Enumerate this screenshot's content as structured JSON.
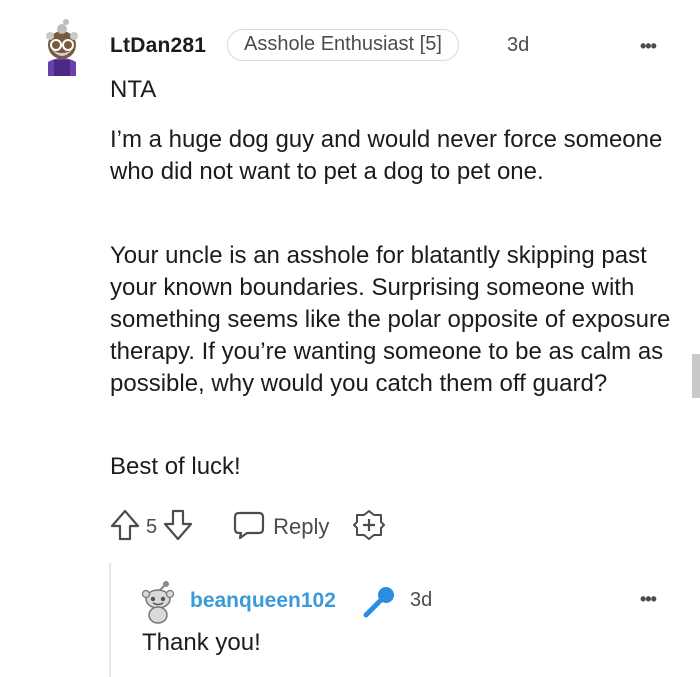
{
  "comment": {
    "username": "LtDan281",
    "flair": "Asshole Enthusiast [5]",
    "time": "3d",
    "more_label": "•••",
    "paragraphs": [
      "NTA",
      "I’m a huge dog guy and would never force someone who did not want to pet a dog to pet one.",
      "Your uncle is an asshole for blatantly skipping past your known boundaries. Surprising someone with something seems like the polar opposite of exposure therapy. If you’re wanting someone to be as calm as possible, why would you catch them off guard?",
      "Best of luck!"
    ],
    "vote_count": "5",
    "reply_label": "Reply"
  },
  "reply": {
    "username": "beanqueen102",
    "time": "3d",
    "more_label": "•••",
    "text": "Thank you!"
  },
  "icons": {
    "upvote": "arrow-up-icon",
    "downvote": "arrow-down-icon",
    "reply": "speech-bubble-icon",
    "award": "award-plus-icon",
    "mic": "microphone-icon"
  },
  "colors": {
    "username_reply": "#3b9ad8",
    "mic": "#2a8ee0",
    "muted": "#4a4d50"
  }
}
